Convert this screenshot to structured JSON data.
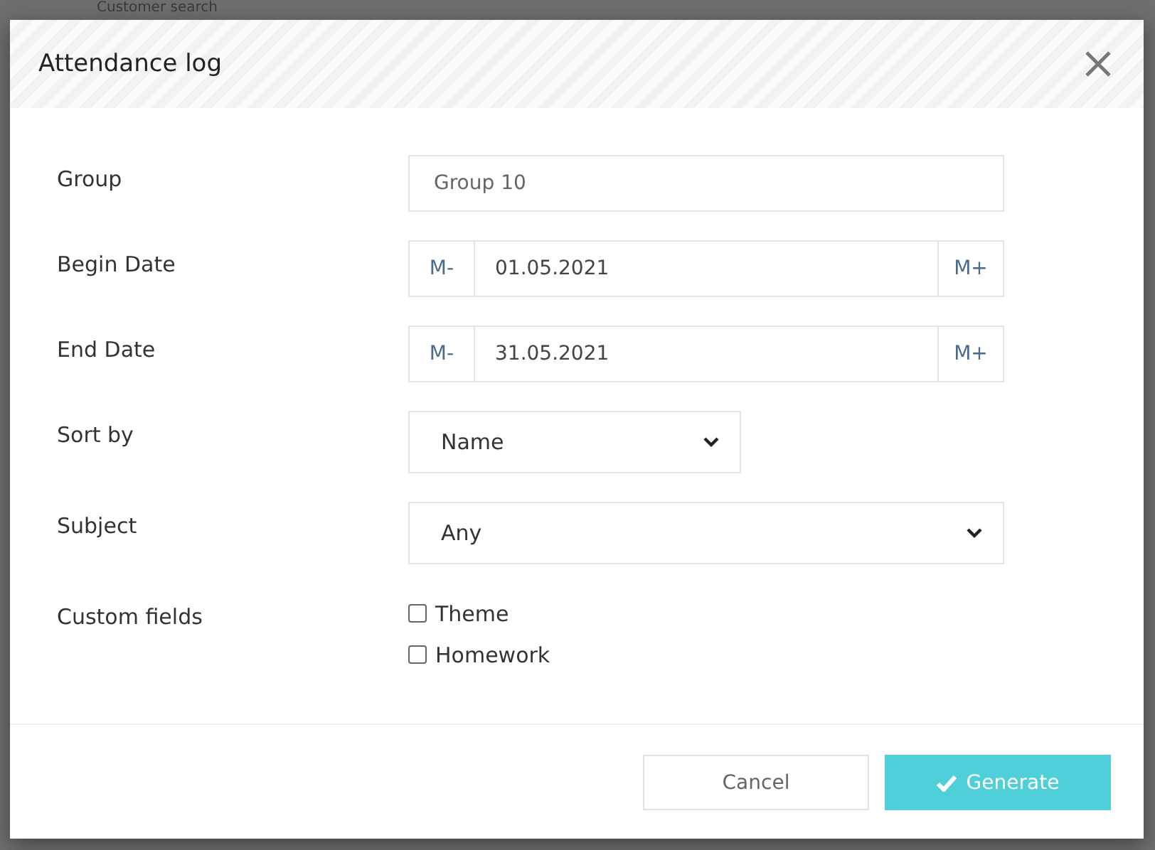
{
  "background": {
    "title": "Customer search"
  },
  "dialog": {
    "title": "Attendance log",
    "fields": [
      {
        "kind": "text",
        "label": "Group",
        "value": "Group 10"
      },
      {
        "kind": "date",
        "label": "Begin Date",
        "value": "01.05.2021",
        "prev": "M-",
        "next": "M+"
      },
      {
        "kind": "date",
        "label": "End Date",
        "value": "31.05.2021",
        "prev": "M-",
        "next": "M+"
      },
      {
        "kind": "shortselect",
        "label": "Sort by",
        "value": "Name"
      },
      {
        "kind": "select",
        "label": "Subject",
        "value": "Any"
      },
      {
        "kind": "checks",
        "label": "Custom fields",
        "options": [
          {
            "label": "Theme",
            "checked": false
          },
          {
            "label": "Homework",
            "checked": false
          }
        ]
      }
    ],
    "buttons": [
      {
        "kind": "secondary",
        "label": "Cancel"
      },
      {
        "kind": "primary",
        "label": "Generate"
      }
    ]
  }
}
